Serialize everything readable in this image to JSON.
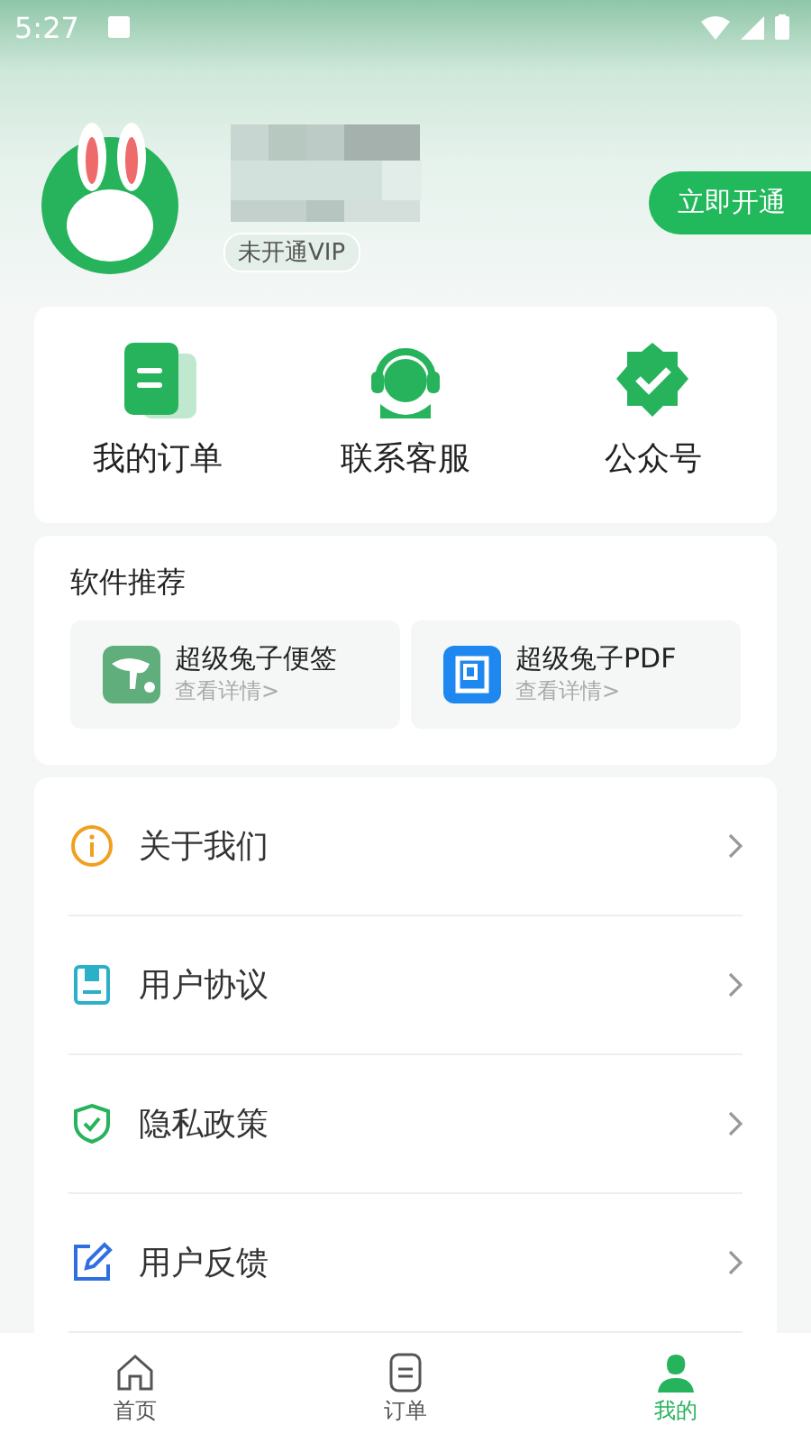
{
  "status_bar": {
    "time": "5:27"
  },
  "header": {
    "vip_badge": "未开通VIP",
    "open_button": "立即开通"
  },
  "quick_actions": [
    "我的订单",
    "联系客服",
    "公众号"
  ],
  "recommend": {
    "title": "软件推荐",
    "apps": [
      {
        "name": "超级兔子便签",
        "link": "查看详情>"
      },
      {
        "name": "超级兔子PDF",
        "link": "查看详情>"
      }
    ]
  },
  "menu": [
    "关于我们",
    "用户协议",
    "隐私政策",
    "用户反馈"
  ],
  "tab_bar": [
    {
      "label": "首页",
      "selected": false
    },
    {
      "label": "订单",
      "selected": false
    },
    {
      "label": "我的",
      "selected": true
    }
  ]
}
